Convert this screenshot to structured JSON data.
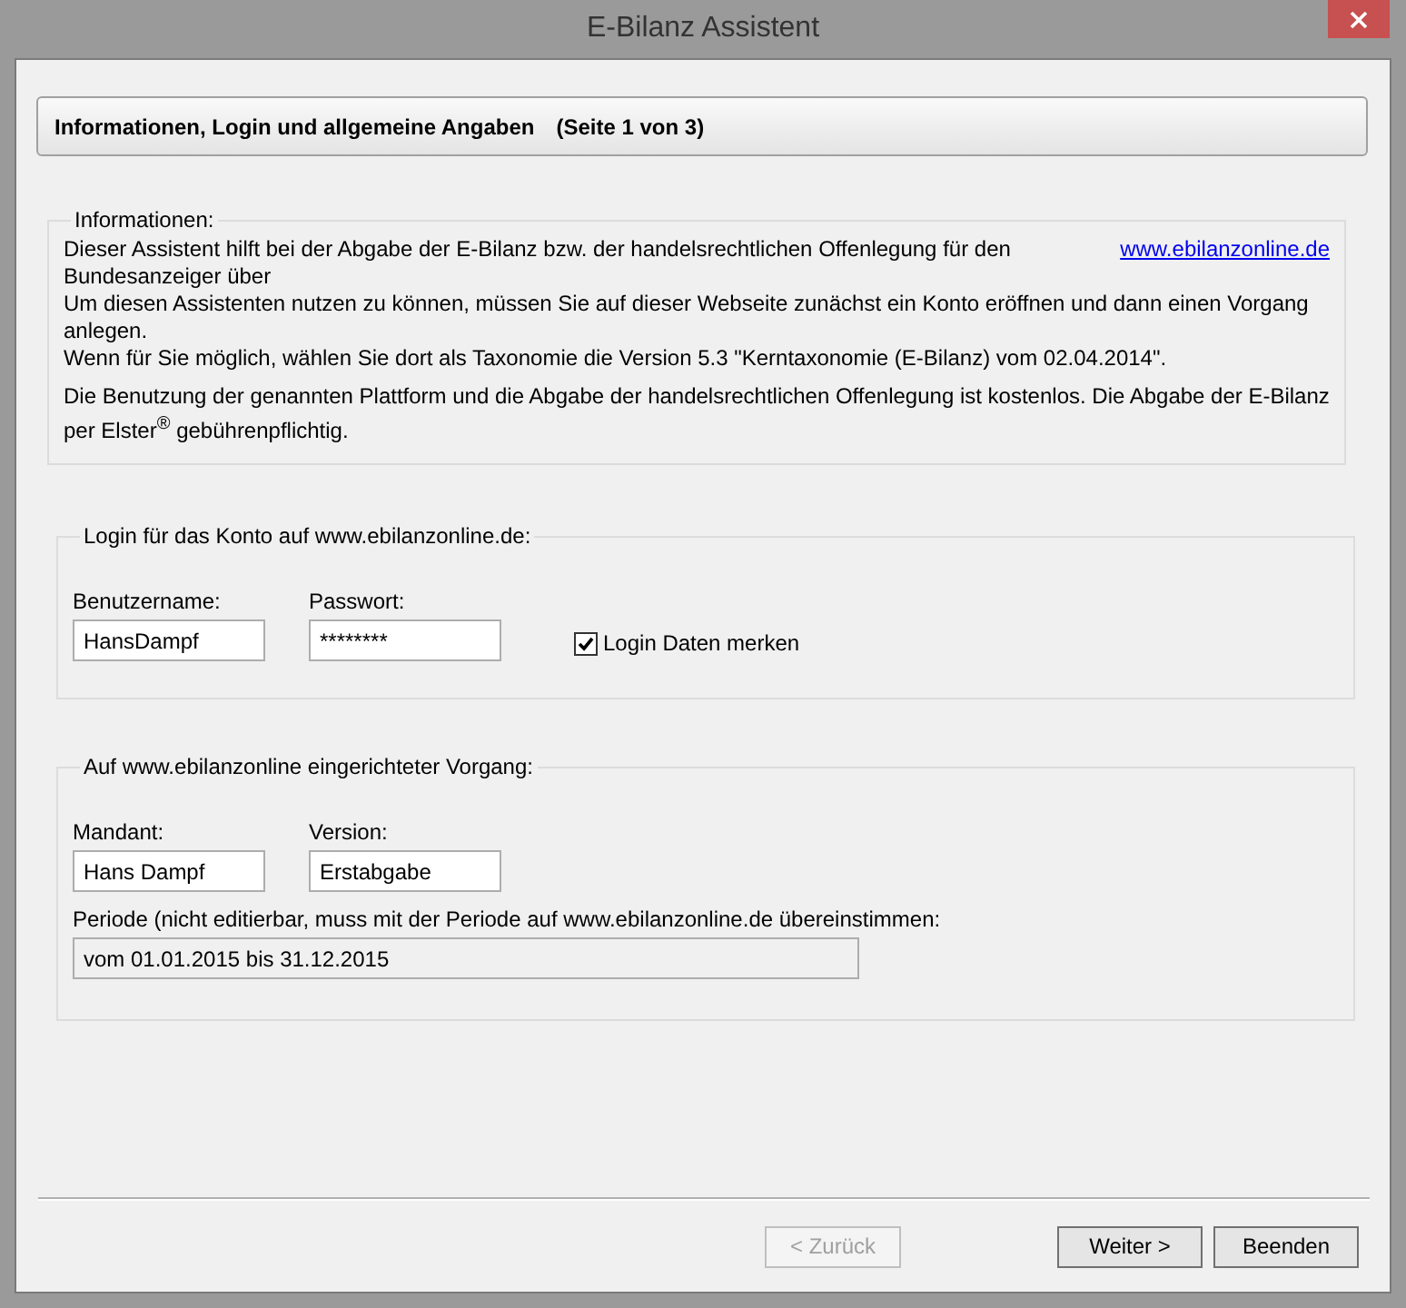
{
  "window": {
    "title": "E-Bilanz Assistent"
  },
  "header": {
    "title": "Informationen, Login und allgemeine Angaben",
    "page": "(Seite 1 von 3)"
  },
  "info": {
    "legend": "Informationen:",
    "lines": [
      "Dieser Assistent hilft bei der Abgabe der E-Bilanz bzw. der handelsrechtlichen Offenlegung für den Bundesanzeiger über",
      "Um diesen Assistenten nutzen zu können, müssen Sie auf dieser Webseite zunächst ein Konto eröffnen und dann einen Vorgang anlegen.",
      "Wenn für Sie möglich, wählen Sie dort als Taxonomie die Version 5.3 \"Kerntaxonomie (E-Bilanz) vom 02.04.2014\"."
    ],
    "link": "www.ebilanzonline.de",
    "note": "Die Benutzung der genannten Plattform und die Abgabe der handelsrechtlichen Offenlegung ist kostenlos. Die Abgabe der E-Bilanz per Elster$^{®}$ gebührenpflichtig."
  },
  "login": {
    "legend": "Login für das Konto auf www.ebilanzonline.de:",
    "username": {
      "label": "Benutzername:",
      "value": "HansDampf"
    },
    "password": {
      "label": "Passwort:",
      "value": "********"
    },
    "remember": {
      "label": "Login Daten merken",
      "checked": true
    }
  },
  "process": {
    "legend": "Auf www.ebilanzonline eingerichteter Vorgang:",
    "client": {
      "label": "Mandant:",
      "value": "Hans Dampf"
    },
    "version": {
      "label": "Version:",
      "value": "Erstabgabe"
    },
    "period": {
      "label": "Periode (nicht editierbar, muss mit der Periode auf www.ebilanzonline.de übereinstimmen:",
      "value": "vom 01.01.2015 bis 31.12.2015",
      "disabled": true
    }
  },
  "buttons": [
    {
      "label": "< Zurück",
      "disabled": true
    },
    {
      "label": "Weiter >",
      "disabled": false
    },
    {
      "label": "Beenden",
      "disabled": false
    }
  ]
}
